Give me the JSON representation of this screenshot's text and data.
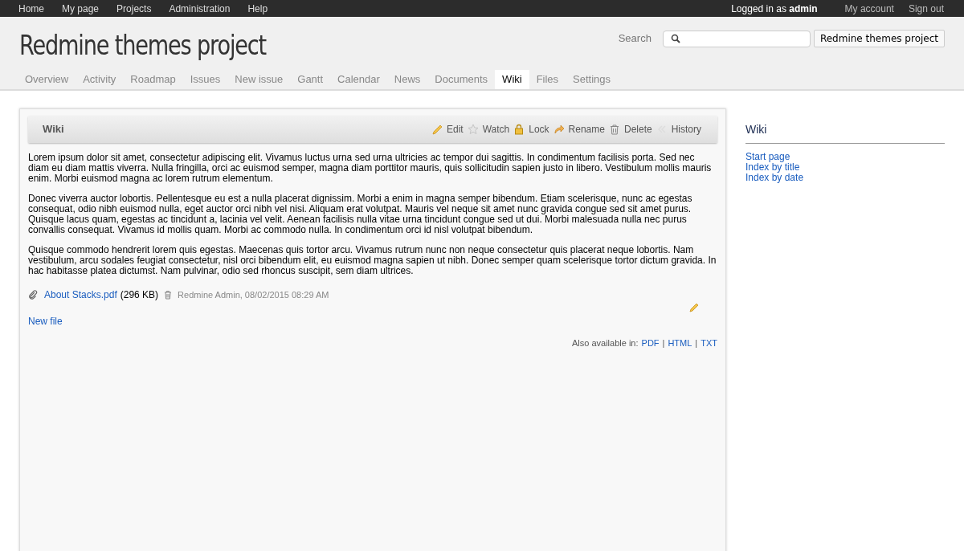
{
  "top_menu": [
    "Home",
    "My page",
    "Projects",
    "Administration",
    "Help"
  ],
  "account": {
    "logged_in": "Logged in as **admin**",
    "links": [
      "My account",
      "Sign out"
    ]
  },
  "header": {
    "title": "Redmine themes project",
    "search_label": "Search",
    "project_button": "Redmine themes project"
  },
  "tabs": [
    {
      "label": "Overview",
      "selected": false
    },
    {
      "label": "Activity",
      "selected": false
    },
    {
      "label": "Roadmap",
      "selected": false
    },
    {
      "label": "Issues",
      "selected": false
    },
    {
      "label": "New issue",
      "selected": false
    },
    {
      "label": "Gantt",
      "selected": false
    },
    {
      "label": "Calendar",
      "selected": false
    },
    {
      "label": "News",
      "selected": false
    },
    {
      "label": "Documents",
      "selected": false
    },
    {
      "label": "Wiki",
      "selected": true
    },
    {
      "label": "Files",
      "selected": false
    },
    {
      "label": "Settings",
      "selected": false
    }
  ],
  "wiki": {
    "title": "Wiki",
    "actions": [
      {
        "kind": "edit",
        "label": "Edit"
      },
      {
        "kind": "watch",
        "label": "Watch"
      },
      {
        "kind": "lock",
        "label": "Lock"
      },
      {
        "kind": "rename",
        "label": "Rename"
      },
      {
        "kind": "delete",
        "label": "Delete"
      },
      {
        "kind": "history",
        "label": "History"
      }
    ],
    "paragraphs": [
      "Lorem ipsum dolor sit amet, consectetur adipiscing elit. Vivamus luctus urna sed urna ultricies ac tempor dui sagittis. In condimentum facilisis porta. Sed nec diam eu diam mattis viverra. Nulla fringilla, orci ac euismod semper, magna diam porttitor mauris, quis sollicitudin sapien justo in libero. Vestibulum mollis mauris enim. Morbi euismod magna ac lorem rutrum elementum.",
      "Donec viverra auctor lobortis. Pellentesque eu est a nulla placerat dignissim. Morbi a enim in magna semper bibendum. Etiam scelerisque, nunc ac egestas consequat, odio nibh euismod nulla, eget auctor orci nibh vel nisi. Aliquam erat volutpat. Mauris vel neque sit amet nunc gravida congue sed sit amet purus. Quisque lacus quam, egestas ac tincidunt a, lacinia vel velit. Aenean facilisis nulla vitae urna tincidunt congue sed ut dui. Morbi malesuada nulla nec purus convallis consequat. Vivamus id mollis quam. Morbi ac commodo nulla. In condimentum orci id nisl volutpat bibendum.",
      "Quisque commodo hendrerit lorem quis egestas. Maecenas quis tortor arcu. Vivamus rutrum nunc non neque consectetur quis placerat neque lobortis. Nam vestibulum, arcu sodales feugiat consectetur, nisl orci bibendum elit, eu euismod magna sapien ut nibh. Donec semper quam scelerisque tortor dictum gravida. In hac habitasse platea dictumst. Nam pulvinar, odio sed rhoncus suscipit, sem diam ultrices."
    ],
    "attachment": {
      "name": "About Stacks.pdf",
      "size": "(296 KB)",
      "author": "Redmine Admin, 08/02/2015 08:29 AM"
    },
    "new_file": "New file",
    "export_label": "Also available in:",
    "exports": [
      "PDF",
      "HTML",
      "TXT"
    ],
    "export_separator": "|"
  },
  "sidebar": {
    "title": "Wiki",
    "links": [
      "Start page",
      "Index by title",
      "Index by date"
    ]
  }
}
